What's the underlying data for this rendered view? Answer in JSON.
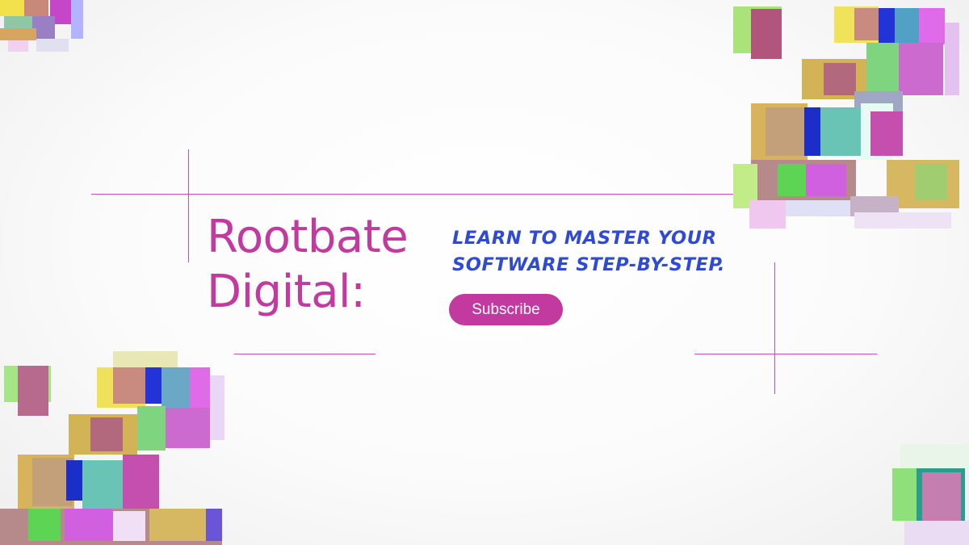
{
  "hero": {
    "title_line1": "Rootbate",
    "title_line2": "Digital:",
    "tagline_line1": "LEARN TO MASTER YOUR",
    "tagline_line2": "SOFTWARE STEP-BY-STEP.",
    "subscribe_label": "Subscribe"
  },
  "colors": {
    "title": "#c2399f",
    "tagline": "#2f4ad6",
    "button_bg": "#c2399f",
    "lines": "#d04bbd"
  },
  "decorations": [
    "glitch-pixel-cluster-top-left",
    "glitch-pixel-cluster-top-right",
    "glitch-pixel-cluster-bottom-left",
    "glitch-pixel-cluster-bottom-right"
  ]
}
